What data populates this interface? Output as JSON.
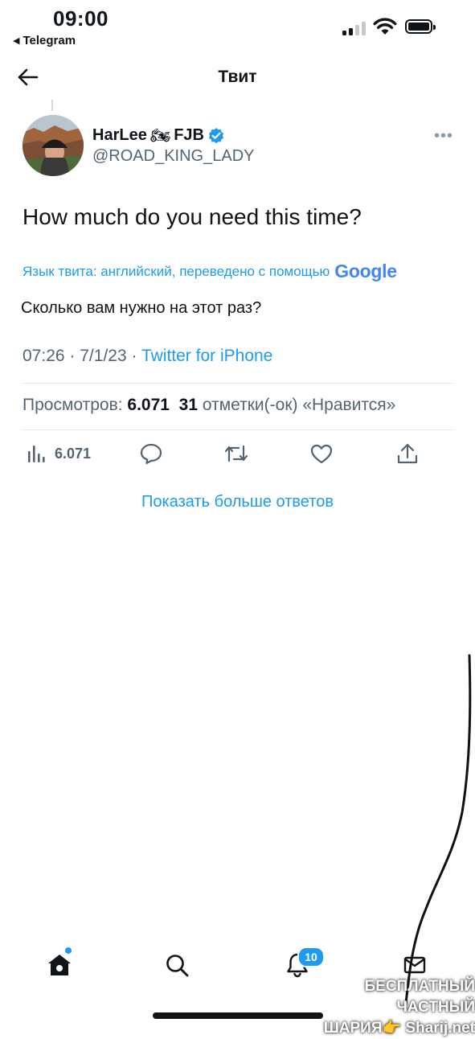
{
  "status_bar": {
    "time": "09:00",
    "back_app": "Telegram"
  },
  "nav": {
    "title": "Твит"
  },
  "tweet": {
    "author_name": "HarLee",
    "author_suffix": "FJB",
    "author_emoji": "🏍",
    "handle": "@ROAD_KING_LADY",
    "text": "How much do you need this time?",
    "translate_note": "Язык твита: английский, переведено с помощью",
    "translate_brand": "Google",
    "translated_text": "Сколько вам нужно на этот раз?",
    "time": "07:26",
    "date": "7/1/23",
    "source": "Twitter for iPhone",
    "separator": "·"
  },
  "stats": {
    "views_label": "Просмотров:",
    "views_value": "6.071",
    "likes_value": "31",
    "likes_label": "отметки(-ок) «Нравится»"
  },
  "actions": {
    "views_count": "6.071"
  },
  "show_more": "Показать больше ответов",
  "tabbar": {
    "notifications_badge": "10"
  },
  "watermark": {
    "line1": "БЕСПЛАТНЫЙ ЧАСТНЫЙ",
    "line2": "ШАРИЯ👉 Sharij.net"
  },
  "colors": {
    "accent": "#1d9bf0",
    "text": "#0f1419",
    "secondary": "#536471"
  }
}
